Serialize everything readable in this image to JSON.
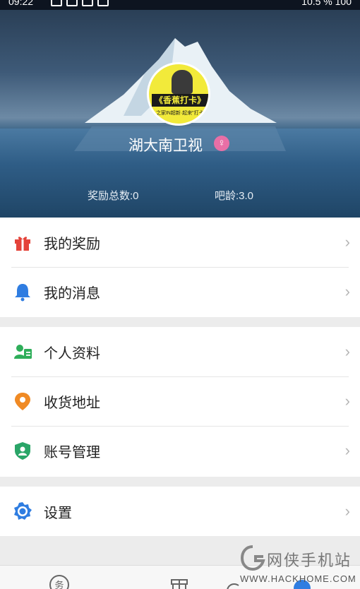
{
  "status_bar": {
    "time": "09:22",
    "right": "10.5 % 100"
  },
  "profile": {
    "avatar_title": "《香蕉打卡》",
    "avatar_subtitle": "之家IN超新·起来\"打卡\"",
    "username": "湖大南卫视",
    "gender_symbol": "♀",
    "reward_total": "奖励总数:0",
    "bar_age": "吧龄:3.0"
  },
  "menu": {
    "group1": [
      {
        "label": "我的奖励",
        "icon": "gift-icon",
        "color": "#e4433a"
      },
      {
        "label": "我的消息",
        "icon": "bell-icon",
        "color": "#2f7de1"
      }
    ],
    "group2": [
      {
        "label": "个人资料",
        "icon": "id-card-icon",
        "color": "#2fae5a"
      },
      {
        "label": "收货地址",
        "icon": "location-pin-icon",
        "color": "#f08a24"
      },
      {
        "label": "账号管理",
        "icon": "shield-user-icon",
        "color": "#2aa568"
      }
    ],
    "group3": [
      {
        "label": "设置",
        "icon": "gear-icon",
        "color": "#2f7de1"
      }
    ],
    "chevron": "›"
  },
  "tabbar": {
    "tab1_icon": "tasks-icon",
    "tab2_icon": "gift-tab-icon",
    "tab3_icon": "chat-tab-icon",
    "tab4_icon": "profile-tab-icon",
    "tab1_glyph": "务"
  },
  "watermark": {
    "title": "网侠手机站",
    "url": "WWW.HACKHOME.COM"
  }
}
